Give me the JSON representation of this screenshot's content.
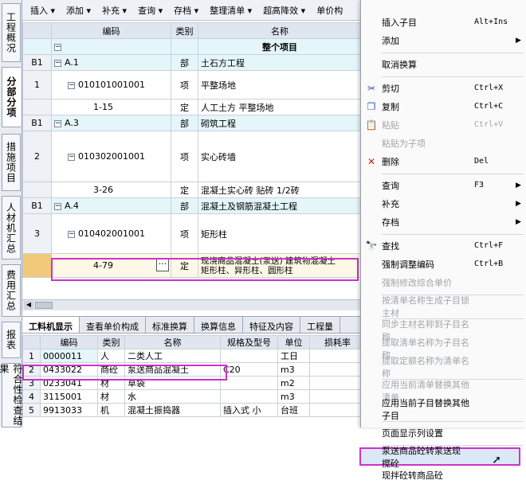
{
  "vtabs": [
    "工程概况",
    "分部分项",
    "措施项目",
    "人材机汇总",
    "费用汇总",
    "报表",
    "符合性检查结果"
  ],
  "toolbar": [
    "插入 ▾",
    "添加 ▾",
    "补充 ▾",
    "查询 ▾",
    "存档 ▾",
    "整理清单 ▾",
    "超高降效 ▾",
    "单价构"
  ],
  "grid": {
    "headers": [
      "编码",
      "类别",
      "名称"
    ],
    "rows": [
      {
        "num": "",
        "code": "",
        "type": "",
        "name": "整个项目",
        "cat": true
      },
      {
        "num": "B1",
        "code": "A.1",
        "type": "部",
        "name": "土石方工程",
        "cat": true
      },
      {
        "num": "1",
        "code": "010101001001",
        "type": "项",
        "name": "平整场地",
        "cat": false
      },
      {
        "num": "",
        "code": "1-15",
        "type": "定",
        "name": "人工土方  平整场地",
        "cat": false
      },
      {
        "num": "B1",
        "code": "A.3",
        "type": "部",
        "name": "砌筑工程",
        "cat": true
      },
      {
        "num": "2",
        "code": "010302001001",
        "type": "项",
        "name": "实心砖墙",
        "cat": false
      },
      {
        "num": "",
        "code": "3-26",
        "type": "定",
        "name": "混凝土实心砖 贴砖 1/2砖",
        "cat": false
      },
      {
        "num": "B1",
        "code": "A.4",
        "type": "部",
        "name": "混凝土及钢筋混凝土工程",
        "cat": true
      },
      {
        "num": "3",
        "code": "010402001001",
        "type": "项",
        "name": "矩形柱",
        "cat": false
      },
      {
        "num": "",
        "code": "4-79",
        "type": "定",
        "name": "现浇商品混凝土(泵送) 建筑物混凝土",
        "name2": "矩形柱、异形柱、圆形柱",
        "cat": false
      }
    ]
  },
  "bottom_tabs": [
    "工料机显示",
    "查看单价构成",
    "标准换算",
    "换算信息",
    "特征及内容",
    "工程量"
  ],
  "bottom_grid": {
    "headers": [
      "编码",
      "类别",
      "名称",
      "规格及型号",
      "单位",
      "损耗率"
    ],
    "rows": [
      [
        "1",
        "0000011",
        "人",
        "二类人工",
        "",
        "工日",
        ""
      ],
      [
        "2",
        "0433022",
        "商砼",
        "泵送商品混凝土",
        "C20",
        "m3",
        ""
      ],
      [
        "3",
        "0233041",
        "材",
        "草袋",
        "",
        "m2",
        ""
      ],
      [
        "4",
        "3115001",
        "材",
        "水",
        "",
        "m3",
        ""
      ],
      [
        "5",
        "9913033",
        "机",
        "混凝土振捣器",
        "插入式 小",
        "台班",
        ""
      ]
    ]
  },
  "menu": [
    {
      "label": "插入子目",
      "shortcut": "Alt+Ins",
      "icon": "",
      "disabled": false,
      "arrow": false
    },
    {
      "label": "添加",
      "shortcut": "",
      "icon": "",
      "disabled": false,
      "arrow": true
    },
    {
      "sep": true
    },
    {
      "label": "取消换算",
      "shortcut": "",
      "icon": "",
      "disabled": false,
      "arrow": false
    },
    {
      "sep": true
    },
    {
      "label": "剪切",
      "shortcut": "Ctrl+X",
      "icon": "✂",
      "disabled": false,
      "arrow": false
    },
    {
      "label": "复制",
      "shortcut": "Ctrl+C",
      "icon": "❐",
      "disabled": false,
      "arrow": false
    },
    {
      "label": "粘贴",
      "shortcut": "Ctrl+V",
      "icon": "📋",
      "disabled": true,
      "arrow": false
    },
    {
      "label": "粘贴为子项",
      "shortcut": "",
      "icon": "",
      "disabled": true,
      "arrow": false
    },
    {
      "label": "删除",
      "shortcut": "Del",
      "icon": "✕",
      "disabled": false,
      "arrow": false
    },
    {
      "sep": true
    },
    {
      "label": "查询",
      "shortcut": "F3",
      "icon": "",
      "disabled": false,
      "arrow": true
    },
    {
      "label": "补充",
      "shortcut": "",
      "icon": "",
      "disabled": false,
      "arrow": true
    },
    {
      "label": "存档",
      "shortcut": "",
      "icon": "",
      "disabled": false,
      "arrow": true
    },
    {
      "sep": true
    },
    {
      "label": "查找",
      "shortcut": "Ctrl+F",
      "icon": "🔭",
      "disabled": false,
      "arrow": false
    },
    {
      "label": "强制调整编码",
      "shortcut": "Ctrl+B",
      "icon": "",
      "disabled": false,
      "arrow": false
    },
    {
      "label": "强制修改综合单价",
      "shortcut": "",
      "icon": "",
      "disabled": true,
      "arrow": false
    },
    {
      "sep": true
    },
    {
      "label": "按清单名称生成子目锁主材",
      "shortcut": "",
      "icon": "",
      "disabled": true,
      "arrow": false
    },
    {
      "sep": true
    },
    {
      "label": "同步主材名称到子目名称",
      "shortcut": "",
      "icon": "",
      "disabled": true,
      "arrow": false
    },
    {
      "label": "提取清单名称为子目名称",
      "shortcut": "",
      "icon": "",
      "disabled": true,
      "arrow": false
    },
    {
      "label": "提取定额名称为清单名称",
      "shortcut": "",
      "icon": "",
      "disabled": true,
      "arrow": false
    },
    {
      "sep": true
    },
    {
      "label": "应用当前清单替换其他清单",
      "shortcut": "",
      "icon": "",
      "disabled": true,
      "arrow": false
    },
    {
      "label": "应用当前子目替换其他子目",
      "shortcut": "",
      "icon": "",
      "disabled": false,
      "arrow": false
    },
    {
      "sep": true
    },
    {
      "label": "页面显示列设置",
      "shortcut": "",
      "icon": "",
      "disabled": false,
      "arrow": false
    },
    {
      "sep": true
    },
    {
      "label": "泵送商品砼转泵送现搅砼",
      "shortcut": "",
      "icon": "",
      "disabled": false,
      "arrow": false,
      "selected": true
    },
    {
      "label": "现拌砼转商品砼",
      "shortcut": "",
      "icon": "",
      "disabled": false,
      "arrow": false
    }
  ]
}
